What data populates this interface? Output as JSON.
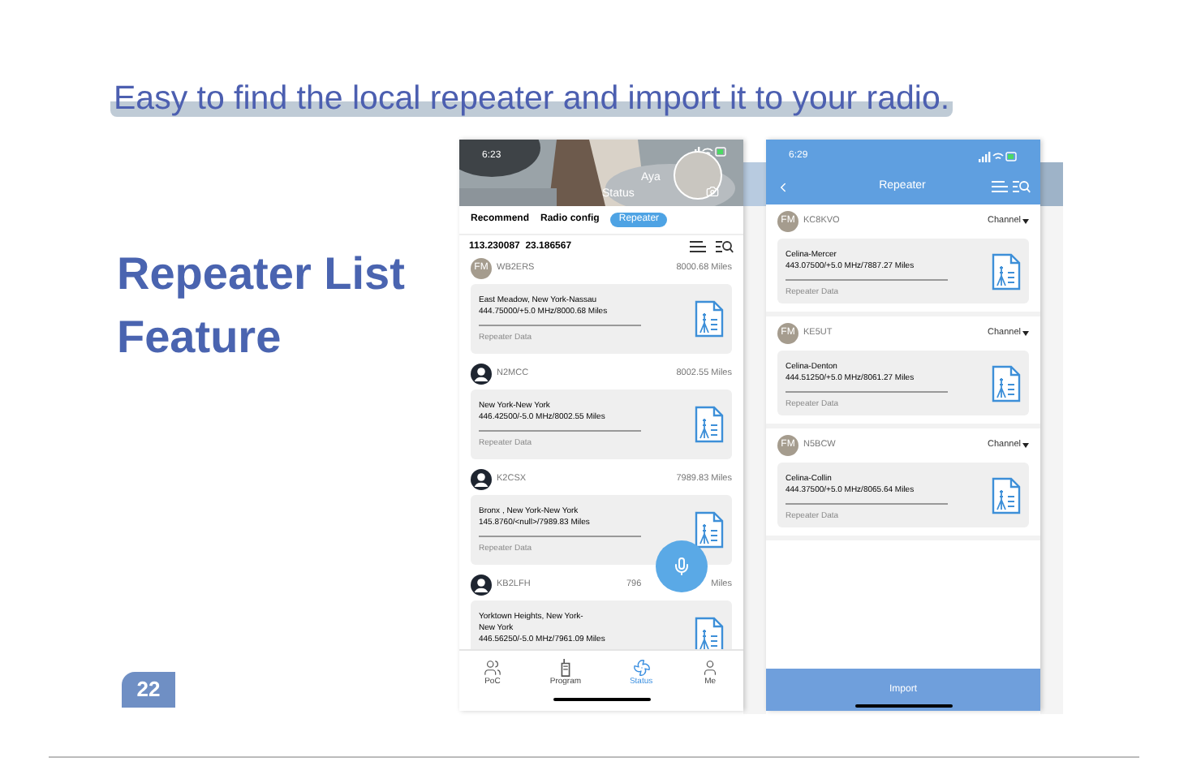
{
  "headline": "Easy to find the local repeater and import it to your radio.",
  "feature_title": [
    "Repeater List",
    "Feature"
  ],
  "page_number": "22",
  "phone_list": {
    "time": "6:23",
    "header_label": "Status",
    "user_name": "Aya",
    "tabs": [
      {
        "label": "Recommend",
        "selected": false
      },
      {
        "label": "Radio config",
        "selected": false
      },
      {
        "label": "Repeater",
        "selected": true
      }
    ],
    "coordinates": "113.230087  23.186567",
    "entries": [
      {
        "kind": "fm",
        "avatar_text": "FM",
        "callsign": "WB2ERS",
        "distance": "8000.68 Miles",
        "lines": [
          "East Meadow, New York-Nassau",
          "444.75000/+5.0 MHz/8000.68 Miles"
        ],
        "data_label": "Repeater Data"
      },
      {
        "kind": "person",
        "callsign": "N2MCC",
        "distance": "8002.55 Miles",
        "lines": [
          "New York-New York",
          "446.42500/-5.0 MHz/8002.55 Miles"
        ],
        "data_label": "Repeater Data"
      },
      {
        "kind": "person",
        "callsign": "K2CSX",
        "distance": "7989.83 Miles",
        "lines": [
          "Bronx , New York-New York",
          "145.8760/<null>/7989.83 Miles"
        ],
        "data_label": "Repeater Data"
      },
      {
        "kind": "person",
        "callsign": "KB2LFH",
        "distance": "796",
        "distance_tail": "Miles",
        "lines": [
          "Yorktown Heights, New York-",
          "New York",
          "446.56250/-5.0 MHz/7961.09 Miles"
        ]
      }
    ],
    "nav": [
      {
        "label": "PoC",
        "selected": false
      },
      {
        "label": "Program",
        "selected": false
      },
      {
        "label": "Status",
        "selected": true
      },
      {
        "label": "Me",
        "selected": false
      }
    ]
  },
  "phone_repeater": {
    "time": "6:29",
    "title": "Repeater",
    "entries": [
      {
        "avatar_text": "FM",
        "callsign": "KC8KVO",
        "channel": "Channel",
        "lines": [
          "Celina-Mercer",
          "443.07500/+5.0 MHz/7887.27 Miles"
        ],
        "data_label": "Repeater Data"
      },
      {
        "avatar_text": "FM",
        "callsign": "KE5UT",
        "channel": "Channel",
        "lines": [
          "Celina-Denton",
          "444.51250/+5.0 MHz/8061.27 Miles"
        ],
        "data_label": "Repeater Data"
      },
      {
        "avatar_text": "FM",
        "callsign": "N5BCW",
        "channel": "Channel",
        "lines": [
          "Celina-Collin",
          "444.37500/+5.0 MHz/8065.64 Miles"
        ],
        "data_label": "Repeater Data"
      }
    ],
    "import_label": "Import"
  }
}
